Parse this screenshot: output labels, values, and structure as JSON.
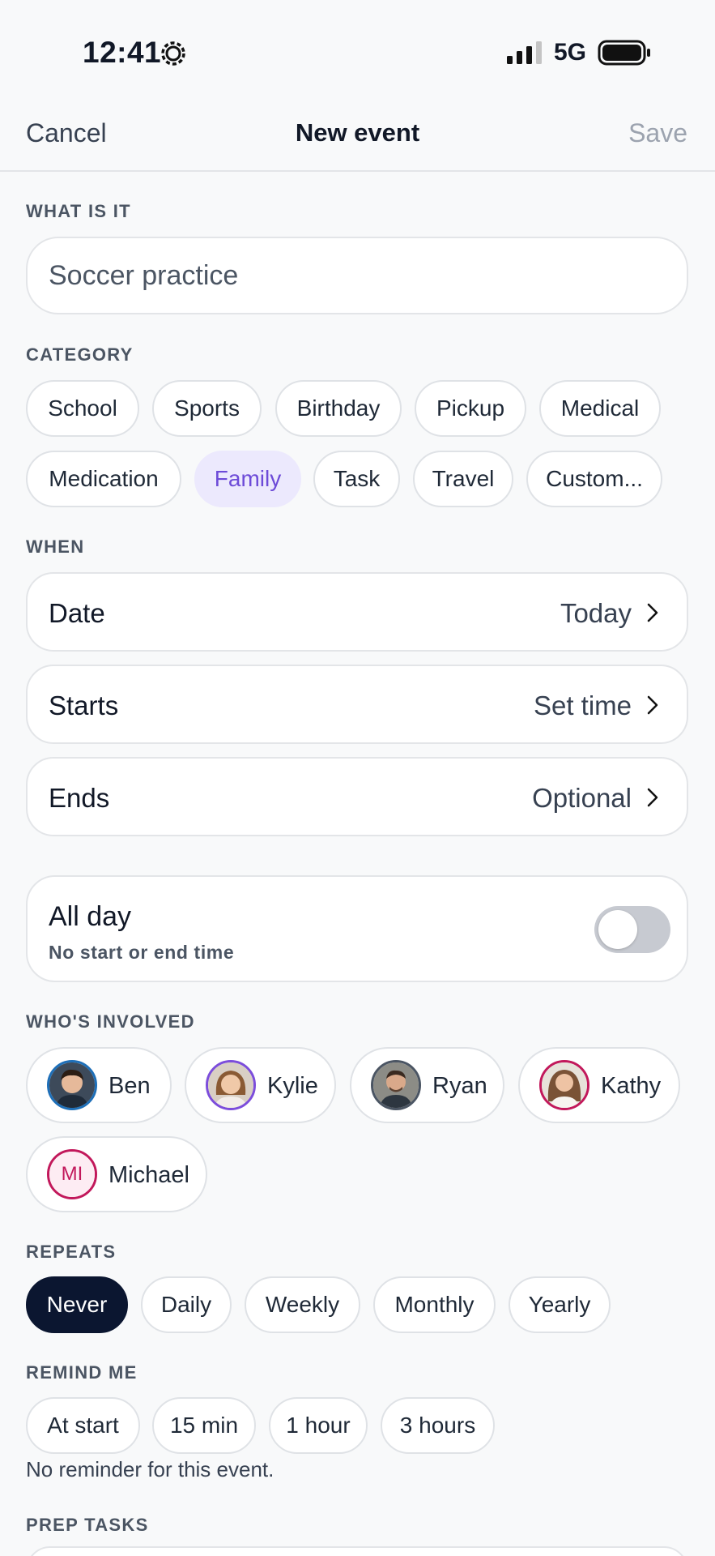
{
  "status": {
    "time": "12:41",
    "network": "5G"
  },
  "nav": {
    "cancel": "Cancel",
    "title": "New event",
    "save": "Save"
  },
  "what": {
    "label": "WHAT IS IT",
    "value": "Soccer practice"
  },
  "category": {
    "label": "CATEGORY",
    "chips": [
      "School",
      "Sports",
      "Birthday",
      "Pickup",
      "Medical",
      "Medication",
      "Family",
      "Task",
      "Travel",
      "Custom..."
    ],
    "selected": "Family"
  },
  "when": {
    "label": "WHEN",
    "date": {
      "label": "Date",
      "value": "Today"
    },
    "starts": {
      "label": "Starts",
      "value": "Set time"
    },
    "ends": {
      "label": "Ends",
      "value": "Optional"
    }
  },
  "allday": {
    "title": "All day",
    "subtitle": "No start or end time",
    "on": false
  },
  "people": {
    "label": "WHO'S INVOLVED",
    "list": [
      {
        "name": "Ben",
        "ring": "#1e6fb8"
      },
      {
        "name": "Kylie",
        "ring": "#7c4ddb"
      },
      {
        "name": "Ryan",
        "ring": "#4b5563"
      },
      {
        "name": "Kathy",
        "ring": "#c2185b"
      },
      {
        "name": "Michael",
        "initials": "MI",
        "ring": "#c2185b"
      }
    ]
  },
  "repeats": {
    "label": "REPEATS",
    "options": [
      "Never",
      "Daily",
      "Weekly",
      "Monthly",
      "Yearly"
    ],
    "selected": "Never"
  },
  "remind": {
    "label": "REMIND ME",
    "options": [
      "At start",
      "15 min",
      "1 hour",
      "3 hours"
    ],
    "note": "No reminder for this event."
  },
  "prep": {
    "label": "PREP TASKS"
  },
  "colors": {
    "accent": "#6d4bd8",
    "accent_bg": "#ece9fd",
    "dark": "#0b1630"
  }
}
